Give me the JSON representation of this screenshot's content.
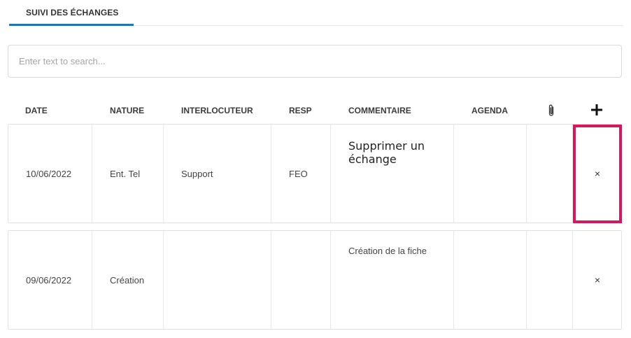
{
  "tabs": [
    {
      "label": "SUIVI DES ÉCHANGES",
      "active": true
    }
  ],
  "search": {
    "placeholder": "Enter text to search..."
  },
  "columns": {
    "date": "DATE",
    "nature": "NATURE",
    "interlocuteur": "INTERLOCUTEUR",
    "resp": "RESP",
    "commentaire": "COMMENTAIRE",
    "agenda": "AGENDA",
    "attachment_icon": "paperclip-icon",
    "add_icon": "plus-icon"
  },
  "rows": [
    {
      "date": "10/06/2022",
      "nature": "Ent. Tel",
      "interlocuteur": "Support",
      "resp": "FEO",
      "commentaire": "",
      "agenda": "",
      "delete_label": "×"
    },
    {
      "date": "09/06/2022",
      "nature": "Création",
      "interlocuteur": "",
      "resp": "",
      "commentaire": "Création de la fiche",
      "agenda": "",
      "delete_label": "×"
    }
  ],
  "tooltip": {
    "text": "Supprimer un échange"
  },
  "colors": {
    "accent": "#1f74bd",
    "highlight": "#d1195e"
  }
}
